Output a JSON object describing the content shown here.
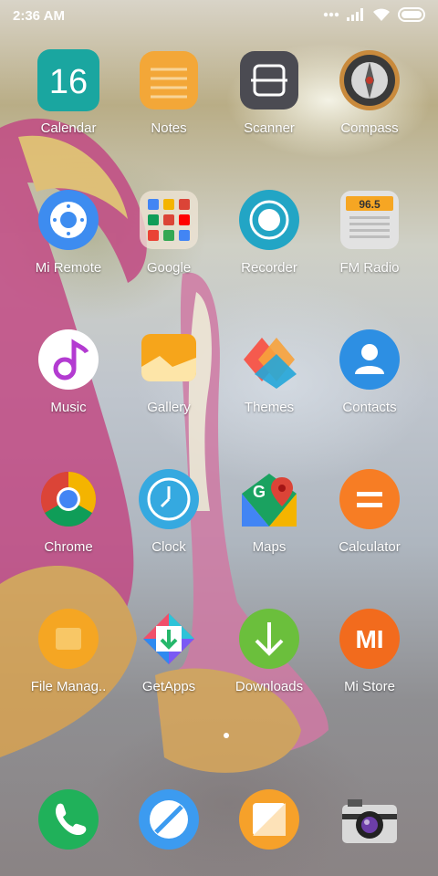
{
  "status_bar": {
    "time": "2:36 AM",
    "icons": [
      "more-dots-icon",
      "signal-icon",
      "wifi-icon",
      "battery-icon"
    ]
  },
  "apps": [
    {
      "label": "Calendar",
      "icon": "calendar-icon",
      "badge_text": "16"
    },
    {
      "label": "Notes",
      "icon": "notes-icon"
    },
    {
      "label": "Scanner",
      "icon": "scanner-icon"
    },
    {
      "label": "Compass",
      "icon": "compass-icon"
    },
    {
      "label": "Mi Remote",
      "icon": "remote-icon"
    },
    {
      "label": "Google",
      "icon": "google-folder-icon"
    },
    {
      "label": "Recorder",
      "icon": "recorder-icon"
    },
    {
      "label": "FM Radio",
      "icon": "radio-icon",
      "display_text": "96.5"
    },
    {
      "label": "Music",
      "icon": "music-note-icon"
    },
    {
      "label": "Gallery",
      "icon": "gallery-icon"
    },
    {
      "label": "Themes",
      "icon": "themes-icon"
    },
    {
      "label": "Contacts",
      "icon": "contact-person-icon"
    },
    {
      "label": "Chrome",
      "icon": "chrome-icon"
    },
    {
      "label": "Clock",
      "icon": "clock-icon"
    },
    {
      "label": "Maps",
      "icon": "maps-icon"
    },
    {
      "label": "Calculator",
      "icon": "calculator-icon"
    },
    {
      "label": "File Manag..",
      "icon": "file-manager-icon"
    },
    {
      "label": "GetApps",
      "icon": "getapps-icon"
    },
    {
      "label": "Downloads",
      "icon": "download-arrow-icon"
    },
    {
      "label": "Mi Store",
      "icon": "mi-logo-icon",
      "logo_text": "MI"
    }
  ],
  "dock": [
    {
      "icon": "phone-icon"
    },
    {
      "icon": "browser-icon"
    },
    {
      "icon": "messaging-icon"
    },
    {
      "icon": "camera-icon"
    }
  ],
  "colors": {
    "calendar": "#1aa6a0",
    "notes": "#f3a738",
    "scanner": "#4b4b52",
    "remote": "#3d8cf0",
    "recorder": "#22a5c5",
    "music": "#ffffff",
    "gallery": "#f6a51b",
    "contacts": "#2d8fe3",
    "clock": "#35a9e0",
    "calculator": "#f77d24",
    "file_manager": "#f5a623",
    "downloads": "#6bbf3c",
    "mi_store": "#f26b1d",
    "phone": "#20b15a",
    "browser": "#3c9bf0",
    "messaging": "#f6a12a"
  }
}
